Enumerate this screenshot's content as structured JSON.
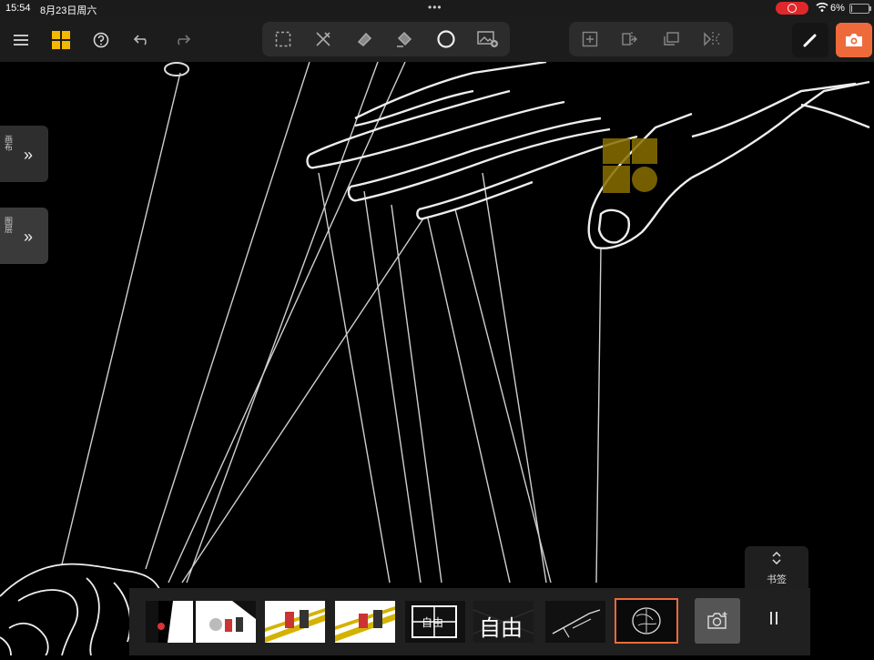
{
  "status_bar": {
    "time": "15:54",
    "date": "8月23日周六",
    "battery": "6%",
    "battery_level": 0.06,
    "screen_recording": true
  },
  "toolbar": {
    "left_icons": [
      "menu-icon",
      "app-grid-icon",
      "help-icon",
      "undo-icon",
      "redo-icon"
    ],
    "draw_tools": [
      "selection-icon",
      "pen-cross-icon",
      "eraser-icon",
      "fill-bucket-icon",
      "brush-circle-icon",
      "image-add-icon"
    ],
    "frame_tools": [
      "add-frame-icon",
      "split-frame-icon",
      "duplicate-frame-icon",
      "flip-frame-icon"
    ],
    "right_icons": [
      "pencil-icon",
      "camera-icon"
    ],
    "accent_color": "#ef6a3a",
    "logo_color": "#f5b800"
  },
  "side_tabs": [
    {
      "label": "画布"
    },
    {
      "label": "图层"
    }
  ],
  "bookmark": {
    "label": "书签"
  },
  "filmstrip": {
    "thumbnails": [
      {
        "caption": ""
      },
      {
        "caption": ""
      },
      {
        "caption": ""
      },
      {
        "caption": ""
      },
      {
        "caption": "自由"
      },
      {
        "caption": "自由"
      },
      {
        "caption": ""
      },
      {
        "caption": ""
      }
    ],
    "active_index": 7,
    "add_snapshot_icon": "camera-add-icon",
    "pause_icon": "pause-icon"
  }
}
